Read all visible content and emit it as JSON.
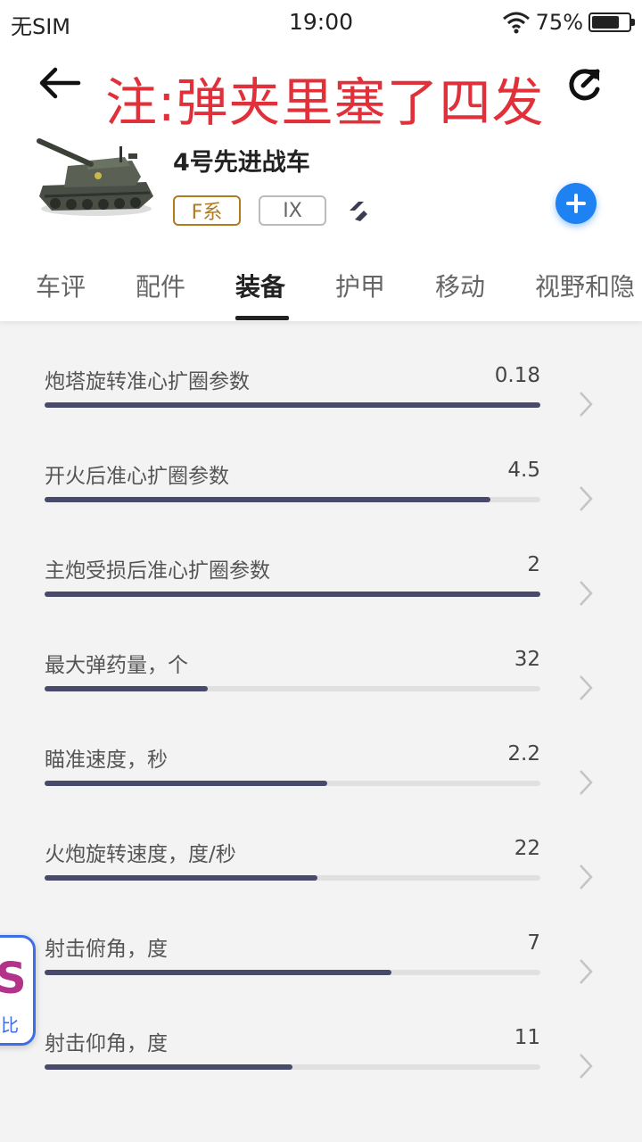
{
  "status_bar": {
    "carrier": "无SIM",
    "time": "19:00",
    "battery_pct": "75%",
    "battery_level": 0.75
  },
  "header": {
    "note": "注:弹夹里塞了四发"
  },
  "tank": {
    "name": "4号先进战车",
    "nation_badge": "F系",
    "tier_badge": "IX"
  },
  "tabs": [
    {
      "label": "车评",
      "active": false
    },
    {
      "label": "配件",
      "active": false
    },
    {
      "label": "装备",
      "active": true
    },
    {
      "label": "护甲",
      "active": false
    },
    {
      "label": "移动",
      "active": false
    },
    {
      "label": "视野和隐",
      "active": false
    }
  ],
  "stats": [
    {
      "label": "炮塔旋转准心扩圈参数",
      "value": "0.18",
      "fill": 1.0
    },
    {
      "label": "开火后准心扩圈参数",
      "value": "4.5",
      "fill": 0.9
    },
    {
      "label": "主炮受损后准心扩圈参数",
      "value": "2",
      "fill": 1.0
    },
    {
      "label": "最大弹药量，个",
      "value": "32",
      "fill": 0.33
    },
    {
      "label": "瞄准速度，秒",
      "value": "2.2",
      "fill": 0.57
    },
    {
      "label": "火炮旋转速度，度/秒",
      "value": "22",
      "fill": 0.55
    },
    {
      "label": "射击俯角，度",
      "value": "7",
      "fill": 0.7
    },
    {
      "label": "射击仰角，度",
      "value": "11",
      "fill": 0.5
    }
  ],
  "floating_badge": {
    "letter": "S",
    "text": "比"
  },
  "colors": {
    "accent_blue": "#1e82f2",
    "note_red": "#e0303a",
    "bar": "#474a6a",
    "nation_gold": "#b07a1e"
  },
  "icons": [
    "wifi-icon",
    "battery-icon",
    "back-arrow-icon",
    "share-icon",
    "tank-image",
    "tank-class-icon",
    "add-icon",
    "chevron-right-icon"
  ]
}
